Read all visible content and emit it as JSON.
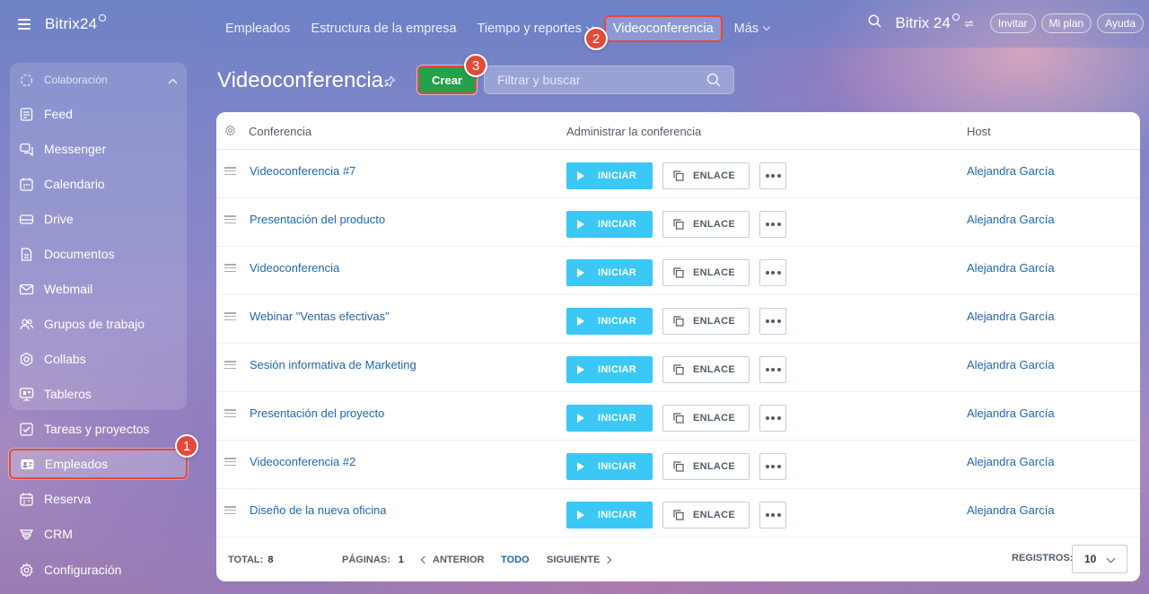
{
  "app": {
    "brand": "Bitrix24",
    "brand_top": "Bitrix 24"
  },
  "sidebar": {
    "section_label": "Colaboración",
    "items": [
      {
        "label": "Feed",
        "icon": "feed-icon"
      },
      {
        "label": "Messenger",
        "icon": "chat-icon"
      },
      {
        "label": "Calendario",
        "icon": "calendar-icon"
      },
      {
        "label": "Drive",
        "icon": "drive-icon"
      },
      {
        "label": "Documentos",
        "icon": "document-icon"
      },
      {
        "label": "Webmail",
        "icon": "mail-icon"
      },
      {
        "label": "Grupos de trabajo",
        "icon": "groups-icon"
      },
      {
        "label": "Collabs",
        "icon": "collabs-icon"
      },
      {
        "label": "Tableros",
        "icon": "boards-icon"
      },
      {
        "label": "Tareas y proyectos",
        "icon": "tasks-icon"
      },
      {
        "label": "Empleados",
        "icon": "employees-icon",
        "active": true
      },
      {
        "label": "Reserva",
        "icon": "booking-icon"
      },
      {
        "label": "CRM",
        "icon": "crm-icon"
      },
      {
        "label": "Configuración",
        "icon": "gear-icon"
      }
    ]
  },
  "topnav": {
    "items": [
      {
        "label": "Empleados"
      },
      {
        "label": "Estructura de la empresa"
      },
      {
        "label": "Tiempo y reportes",
        "dropdown": true
      },
      {
        "label": "Videoconferencia",
        "active": true
      },
      {
        "label": "Más",
        "dropdown": true
      }
    ],
    "invite": "Invitar",
    "plan": "Mi plan",
    "help": "Ayuda"
  },
  "badges": {
    "b1": "1",
    "b2": "2",
    "b3": "3"
  },
  "page": {
    "title": "Videoconferencia",
    "create_label": "Crear",
    "search_placeholder": "Filtrar y buscar"
  },
  "grid": {
    "columns": {
      "conference": "Conferencia",
      "manage": "Administrar la conferencia",
      "host": "Host"
    },
    "start_label": "INICIAR",
    "link_label": "ENLACE",
    "rows": [
      {
        "name": "Videoconferencia #7",
        "host": "Alejandra García"
      },
      {
        "name": "Presentación del producto",
        "host": "Alejandra García"
      },
      {
        "name": "Videoconferencia",
        "host": "Alejandra García"
      },
      {
        "name": "Webinar \"Ventas efectivas\"",
        "host": "Alejandra García"
      },
      {
        "name": "Sesión informativa de Marketing",
        "host": "Alejandra García"
      },
      {
        "name": "Presentación del proyecto",
        "host": "Alejandra García"
      },
      {
        "name": "Videoconferencia #2",
        "host": "Alejandra García"
      },
      {
        "name": "Diseño de la nueva oficina",
        "host": "Alejandra García"
      }
    ],
    "footer": {
      "total_label": "TOTAL:",
      "total_value": "8",
      "pages_label": "PÁGINAS:",
      "pages_value": "1",
      "prev": "ANTERIOR",
      "all": "TODO",
      "next": "SIGUIENTE",
      "records_label": "REGISTROS:",
      "records_value": "10"
    }
  },
  "colors": {
    "accent_green": "#24a14b",
    "start_blue": "#3bc8f5",
    "link_blue": "#2067b0",
    "highlight_red": "#e34a3b"
  }
}
